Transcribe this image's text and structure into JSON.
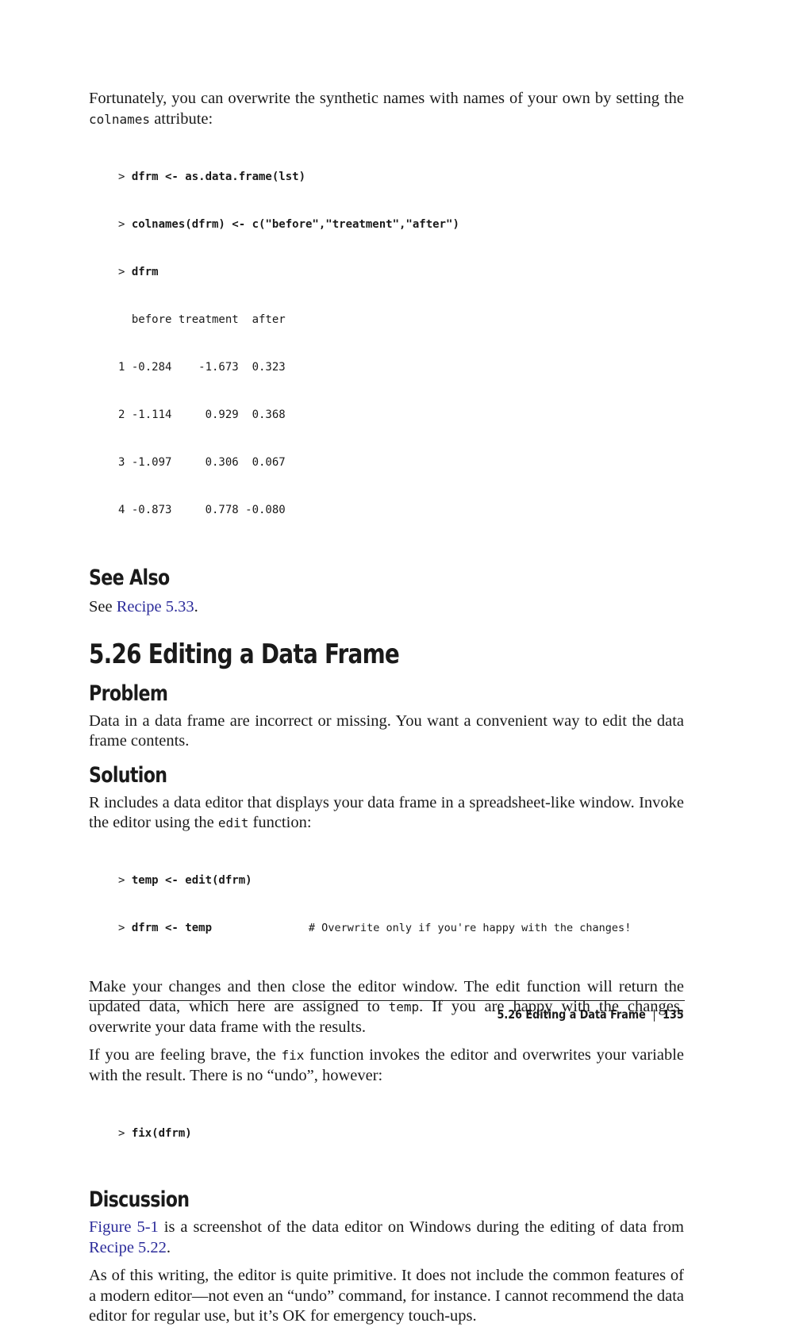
{
  "intro": {
    "text_1": "Fortunately, you can overwrite the synthetic names with names of your own by setting the ",
    "code_1": "colnames",
    "text_2": " attribute:"
  },
  "code_block_1": {
    "lines": [
      {
        "prompt": "> ",
        "input": "dfrm <- as.data.frame(lst)"
      },
      {
        "prompt": "> ",
        "input": "colnames(dfrm) <- c(\"before\",\"treatment\",\"after\")"
      },
      {
        "prompt": "> ",
        "input": "dfrm"
      }
    ],
    "header": "  before treatment  after",
    "rows": [
      "1 -0.284    -1.673  0.323",
      "2 -1.114     0.929  0.368",
      "3 -1.097     0.306  0.067",
      "4 -0.873     0.778 -0.080"
    ]
  },
  "see_also": {
    "heading": "See Also",
    "text_1": "See ",
    "link": "Recipe 5.33",
    "text_2": "."
  },
  "section": {
    "heading": "5.26  Editing a Data Frame"
  },
  "problem": {
    "heading": "Problem",
    "text": "Data in a data frame are incorrect or missing. You want a convenient way to edit the data frame contents."
  },
  "solution": {
    "heading": "Solution",
    "text_1": "R includes a data editor that displays your data frame in a spreadsheet-like window. Invoke the editor using the ",
    "code_1": "edit",
    "text_2": " function:",
    "code_lines": [
      {
        "prompt": "> ",
        "input": "temp <- edit(dfrm)",
        "comment": ""
      },
      {
        "prompt": "> ",
        "input": "dfrm <- temp",
        "comment": "               # Overwrite only if you're happy with the changes!"
      }
    ],
    "para2_text_1": "Make your changes and then close the editor window. The edit function will return the updated data, which here are assigned to ",
    "para2_code": "temp",
    "para2_text_2": ". If you are happy with the changes, overwrite your data frame with the results.",
    "para3_text_1": "If you are feeling brave, the ",
    "para3_code": "fix",
    "para3_text_2": " function invokes the editor and overwrites your variable with the result. There is no “undo”, however:",
    "code_fix": {
      "prompt": "> ",
      "input": "fix(dfrm)"
    }
  },
  "discussion": {
    "heading": "Discussion",
    "link_1": "Figure 5-1",
    "text_1": " is a screenshot of the data editor on Windows during the editing of data from ",
    "link_2": "Recipe 5.22",
    "text_2": ".",
    "para2": "As of this writing, the editor is quite primitive. It does not include the common features of a modern editor—not even an “undo” command, for instance. I cannot recommend the data editor for regular use, but it’s OK for emergency touch-ups."
  },
  "footer": {
    "section_title": "5.26  Editing a Data Frame",
    "separator": "|",
    "page_number": "135"
  }
}
